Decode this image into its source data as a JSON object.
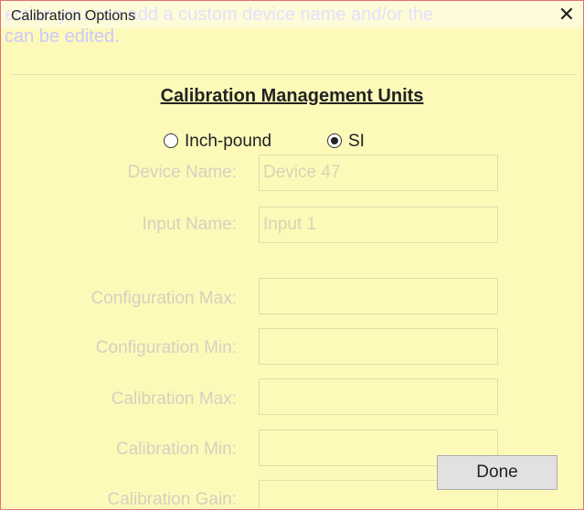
{
  "window": {
    "title": "Calibration Options",
    "close_glyph": "✕"
  },
  "background": {
    "description_line1": "ection you can add a custom device name and/or the",
    "description_line2": "can be edited."
  },
  "heading": "Calibration Management Units",
  "units": {
    "options": [
      {
        "label": "Inch-pound",
        "selected": false
      },
      {
        "label": "SI",
        "selected": true
      }
    ]
  },
  "form": {
    "fields": [
      {
        "label": "Device Name:",
        "value": "Device 47"
      },
      {
        "label": "Input Name:",
        "value": "Input 1"
      },
      {
        "label": "Configuration Max:",
        "value": ""
      },
      {
        "label": "Configuration Min:",
        "value": ""
      },
      {
        "label": "Calibration Max:",
        "value": ""
      },
      {
        "label": "Calibration Min:",
        "value": ""
      },
      {
        "label": "Calibration Gain:",
        "value": ""
      }
    ]
  },
  "done_button": "Done",
  "colors": {
    "overlay": "#fdfab9",
    "border": "#e0707a",
    "ghost_text": "#ccc7ff"
  }
}
